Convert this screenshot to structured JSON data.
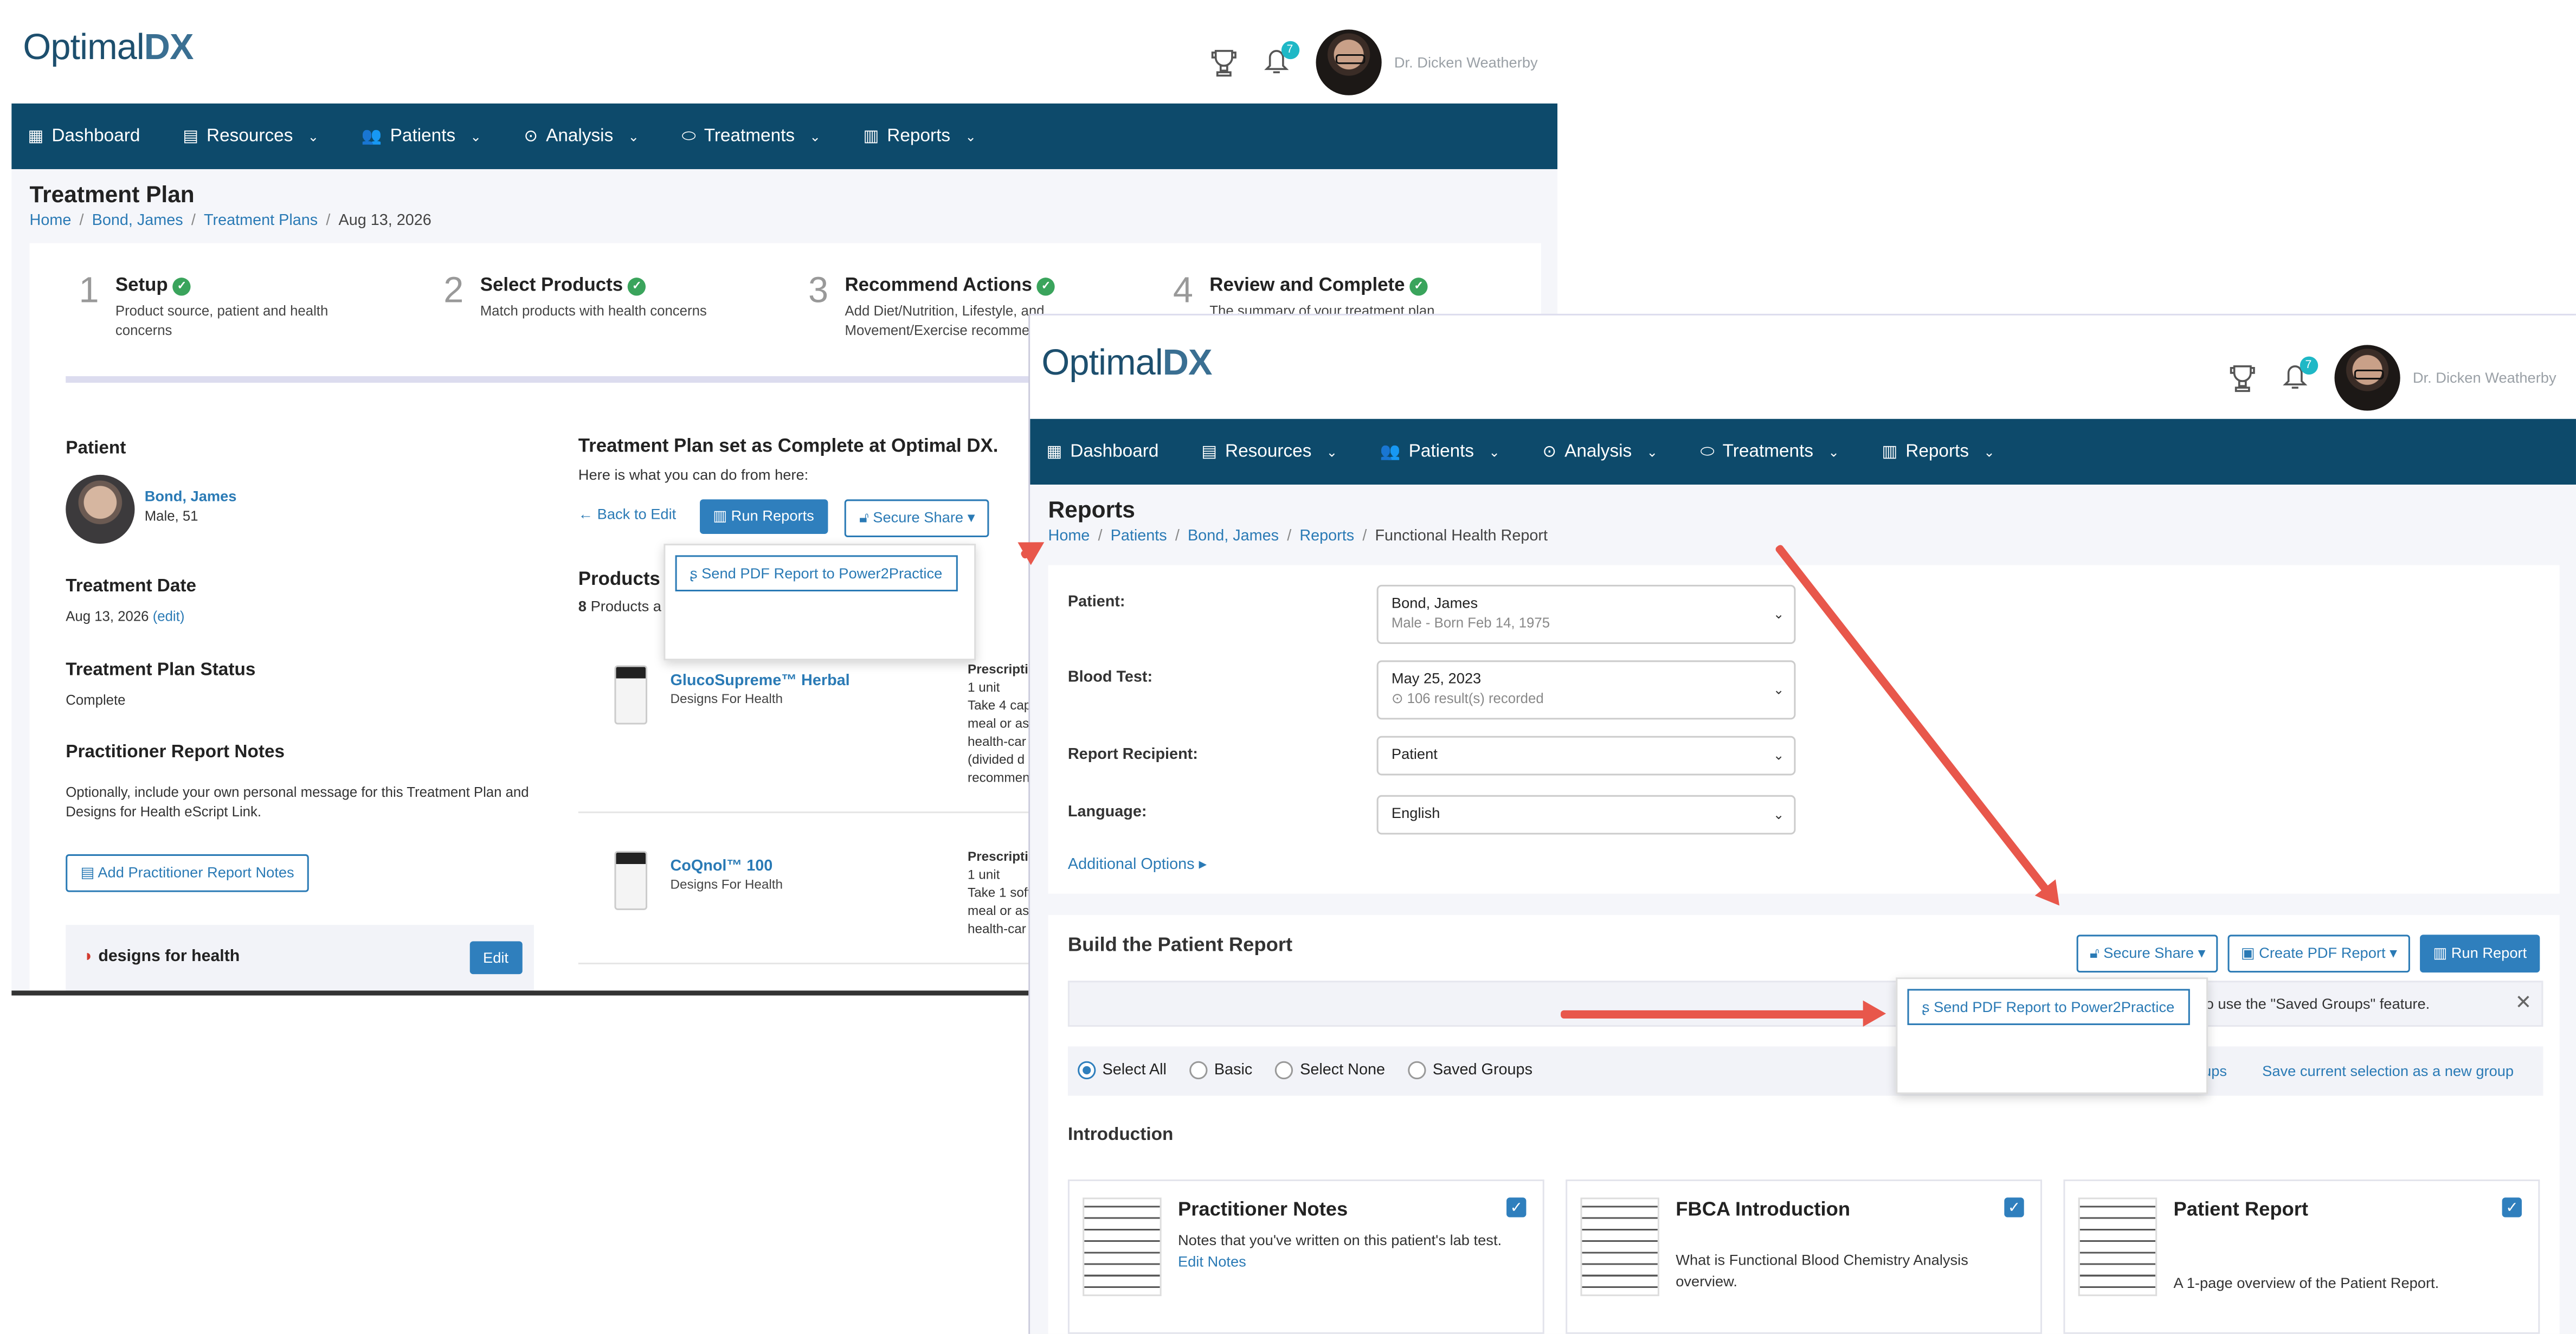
{
  "app": {
    "logo_left": "Optimal",
    "logo_right": "DX",
    "notification_count": "7",
    "user_name": "Dr. Dicken Weatherby"
  },
  "nav": [
    "Dashboard",
    "Resources",
    "Patients",
    "Analysis",
    "Treatments",
    "Reports"
  ],
  "w1": {
    "title": "Treatment Plan",
    "crumbs": [
      "Home",
      "Bond, James",
      "Treatment Plans",
      "Aug 13, 2026"
    ],
    "steps": [
      {
        "num": "1",
        "title": "Setup",
        "desc": "Product source, patient and health concerns"
      },
      {
        "num": "2",
        "title": "Select Products",
        "desc": "Match products with health concerns"
      },
      {
        "num": "3",
        "title": "Recommend Actions",
        "desc": "Add Diet/Nutrition, Lifestyle, and Movement/Exercise recommendations"
      },
      {
        "num": "4",
        "title": "Review and Complete",
        "desc": "The summary of your treatment plan"
      }
    ],
    "patient_label": "Patient",
    "patient_name": "Bond, James",
    "patient_meta": "Male, 51",
    "date_label": "Treatment Date",
    "date_value": "Aug 13, 2026",
    "date_edit": "(edit)",
    "status_label": "Treatment Plan Status",
    "status_value": "Complete",
    "notes_label": "Practitioner Report Notes",
    "notes_desc": "Optionally, include your own personal message for this Treatment Plan and Designs for Health eScript Link.",
    "add_notes_btn": "Add Practitioner Report Notes",
    "dfh_logo": "designs for health",
    "edit_btn": "Edit",
    "complete_heading": "Treatment Plan set as Complete at Optimal DX.",
    "complete_sub": "Here is what you can do from here:",
    "back_btn": "Back to Edit",
    "run_reports_btn": "Run Reports",
    "secure_share_btn": "Secure Share",
    "send_pdf": "Send PDF Report to Power2Practice",
    "products_label": "Products",
    "products_count": "8",
    "products_count_text": "Products a",
    "products": [
      {
        "name": "GlucoSupreme™ Herbal",
        "maker": "Designs For Health",
        "rx": [
          "Prescripti",
          "1 unit",
          "Take 4 cap",
          "meal or as",
          "health-car",
          "(divided d",
          "recommen"
        ]
      },
      {
        "name": "CoQnol™ 100",
        "maker": "Designs For Health",
        "rx": [
          "Prescripti",
          "1 unit",
          "Take 1 soft",
          "meal or as",
          "health-car"
        ]
      }
    ]
  },
  "w2": {
    "title": "Reports",
    "crumbs": [
      "Home",
      "Patients",
      "Bond, James",
      "Reports",
      "Functional Health Report"
    ],
    "form": {
      "patient_label": "Patient:",
      "patient_value": "Bond, James",
      "patient_sub": "Male - Born Feb 14, 1975",
      "blood_label": "Blood Test:",
      "blood_value": "May 25, 2023",
      "blood_sub": "⊙ 106 result(s) recorded",
      "recipient_label": "Report Recipient:",
      "recipient_value": "Patient",
      "language_label": "Language:",
      "language_value": "English",
      "additional": "Additional Options ▸"
    },
    "build_title": "Build the Patient Report",
    "secure_share_btn": "Secure Share",
    "create_pdf_btn": "Create PDF Report",
    "run_report_btn": "Run Report",
    "send_pdf": "Send PDF Report to Power2Practice",
    "info_text": "how to use the \"Saved Groups\" feature.",
    "radios": [
      "Select All",
      "Basic",
      "Select None",
      "Saved Groups"
    ],
    "groups_link": "oups",
    "save_group_link": "Save current selection as a new group",
    "intro_label": "Introduction",
    "cards": [
      {
        "title": "Practitioner Notes",
        "desc": "Notes that you've written on this patient's lab test.",
        "link": "Edit Notes"
      },
      {
        "title": "FBCA Introduction",
        "desc": "What is Functional Blood Chemistry Analysis overview.",
        "link": ""
      },
      {
        "title": "Patient Report",
        "desc": "A 1-page overview of the Patient Report.",
        "link": ""
      }
    ]
  }
}
